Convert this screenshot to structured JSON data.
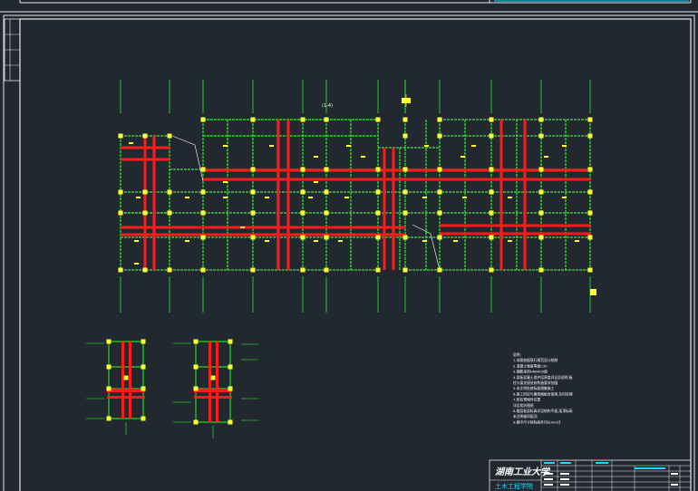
{
  "drawing": {
    "plan_label": "(1-4)",
    "institution": "湖南工业大学",
    "department": "土木工程学院"
  },
  "colors": {
    "background": "#212830",
    "frame": "#e8e8e8",
    "beam": "#2bd12b",
    "rebar": "#ff1a1a",
    "column": "#ffff33",
    "gridline": "#33ff33",
    "note_text": "#ffffff",
    "title_accent": "#00e5ff"
  },
  "notes": {
    "lines": [
      "说明:",
      "1.本图依据现行规范设计绘制",
      "2.混凝土强度等级C30",
      "3.钢筋采用HRB400级",
      "4.梁板混凝土保护层厚度详见总说明,板",
      "  柱与梁交接处按构造要求加强",
      "5.未注明处按标准图集施工",
      "6.施工时应与建筑图配合使用,及时处理",
      "7.所有预埋件位置",
      "  详见相关图纸",
      "8.楼层板面标高详见结构平面,梁顶标高",
      "  未注明者同板顶",
      "9.图中尺寸除标高外均以mm计"
    ]
  }
}
